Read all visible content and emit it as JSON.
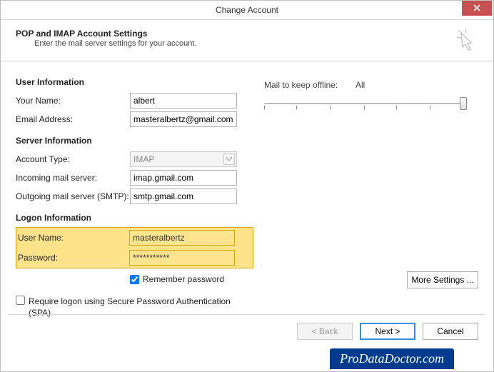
{
  "window": {
    "title": "Change Account"
  },
  "header": {
    "title": "POP and IMAP Account Settings",
    "subtitle": "Enter the mail server settings for your account."
  },
  "sections": {
    "user_info": "User Information",
    "server_info": "Server Information",
    "logon_info": "Logon Information"
  },
  "labels": {
    "your_name": "Your Name:",
    "email": "Email Address:",
    "account_type": "Account Type:",
    "incoming": "Incoming mail server:",
    "outgoing": "Outgoing mail server (SMTP):",
    "user_name": "User Name:",
    "password": "Password:",
    "remember": "Remember password",
    "spa": "Require logon using Secure Password Authentication (SPA)",
    "offline": "Mail to keep offline:",
    "offline_all": "All"
  },
  "values": {
    "your_name": "albert",
    "email": "masteralbertz@gmail.com",
    "account_type": "IMAP",
    "incoming": "imap.gmail.com",
    "outgoing": "smtp.gmail.com",
    "user_name": "masteralbertz",
    "password": "***********",
    "remember_checked": true,
    "spa_checked": false
  },
  "buttons": {
    "more": "More Settings ...",
    "back": "< Back",
    "next": "Next >",
    "cancel": "Cancel"
  },
  "brand": "ProDataDoctor.com"
}
